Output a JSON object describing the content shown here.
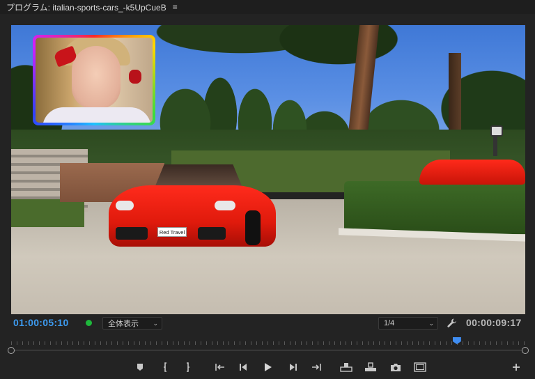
{
  "panel": {
    "title": "プログラム: italian-sports-cars_-k5UpCueB",
    "menu_icon": "hamburger-icon"
  },
  "frame": {
    "license_plate": "Red Travel"
  },
  "controls": {
    "current_timecode": "01:00:05:10",
    "zoom_select": "全体表示",
    "resolution_select": "1/4",
    "duration_timecode": "00:00:09:17",
    "record_indicator_color": "#1eb83b"
  },
  "timeline": {
    "playhead_fraction": 0.867,
    "accent_color": "#3f8df2"
  },
  "transport_buttons": [
    "add-marker",
    "mark-in",
    "mark-out",
    "go-to-in",
    "step-back",
    "play",
    "step-forward",
    "go-to-out",
    "lift",
    "extract",
    "export-frame",
    "comparison-view",
    "add-button"
  ],
  "colors": {
    "timecode_blue": "#3d9bf0",
    "panel_bg": "#232323"
  }
}
